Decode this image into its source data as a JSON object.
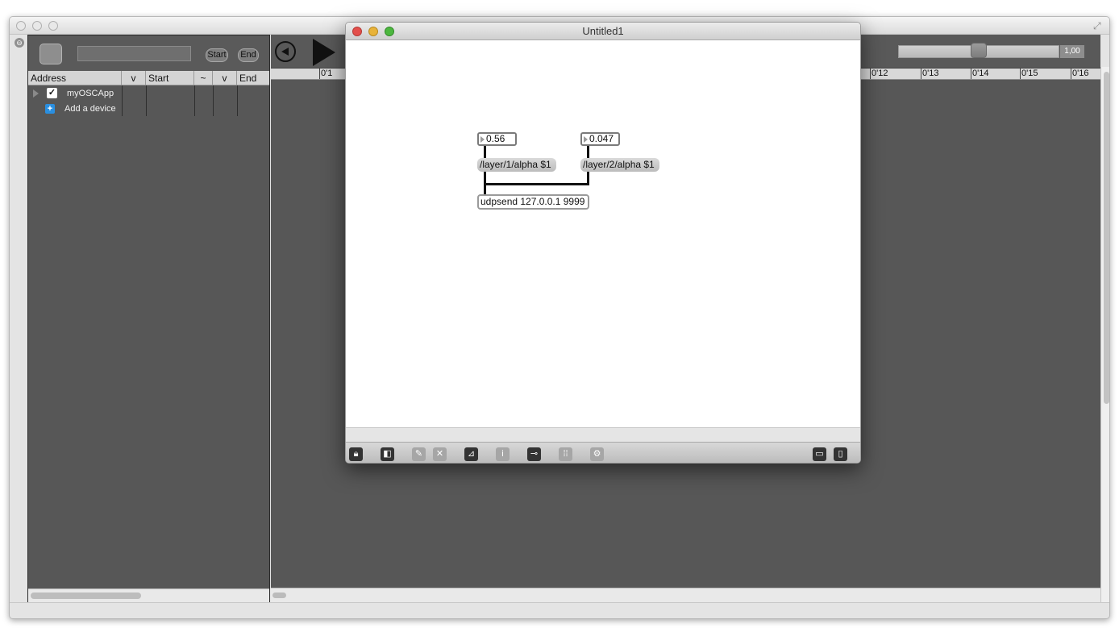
{
  "left_panel": {
    "start_label": "Start",
    "end_label": "End",
    "columns": [
      "Address",
      "v",
      "Start",
      "~",
      "v",
      "End"
    ],
    "devices": [
      {
        "label": "myOSCApp",
        "checked": true
      },
      {
        "label": "Add a device"
      }
    ]
  },
  "timeline": {
    "speed_value": "1,00",
    "ruler_ticks": [
      "0'1",
      "0'12",
      "0'13",
      "0'14",
      "0'15",
      "0'16"
    ]
  },
  "patcher": {
    "title": "Untitled1",
    "number_boxes": [
      "0.56",
      "0.047"
    ],
    "messages": [
      "/layer/1/alpha $1",
      "/layer/2/alpha $1"
    ],
    "object": "udpsend 127.0.0.1 9999"
  },
  "colors": {
    "close": "#e34f4b",
    "minimize": "#e8b33a",
    "zoom": "#4cb73f",
    "panel_bg": "#575757"
  }
}
